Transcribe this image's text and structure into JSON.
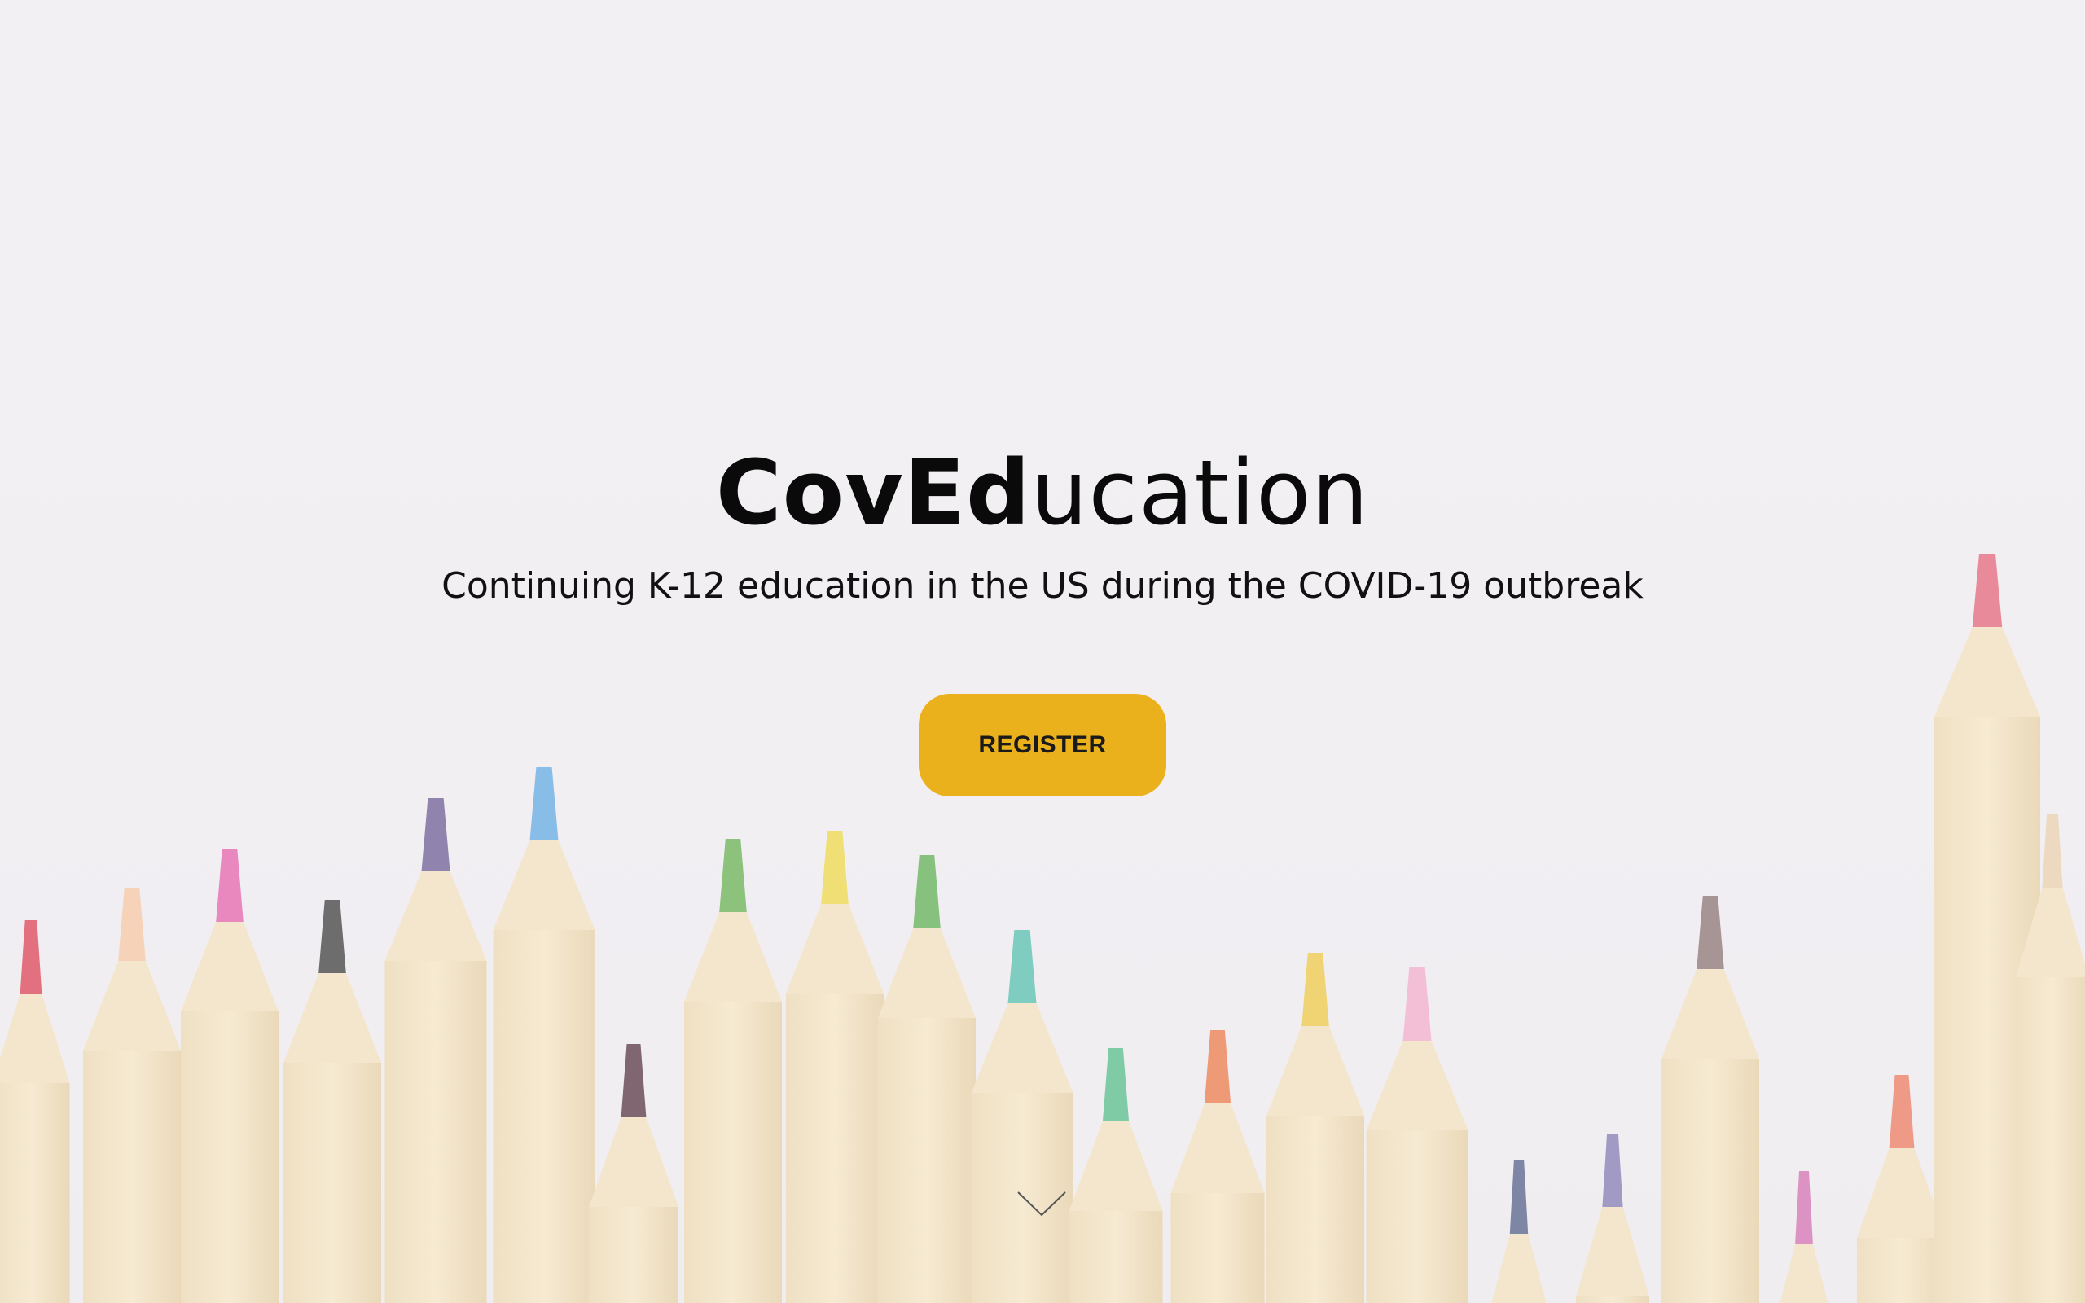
{
  "hero": {
    "title_bold": "CovEd",
    "title_light": "ucation",
    "subtitle": "Continuing K-12 education in the US during the COVID-19 outbreak",
    "register_label": "REGISTER",
    "scroll_icon": "chevron-down-icon",
    "background_image": "colored-pencils-photo"
  },
  "colors": {
    "background": "#f1eff2",
    "button": "#ebb11c",
    "text": "#0a0a0a"
  }
}
